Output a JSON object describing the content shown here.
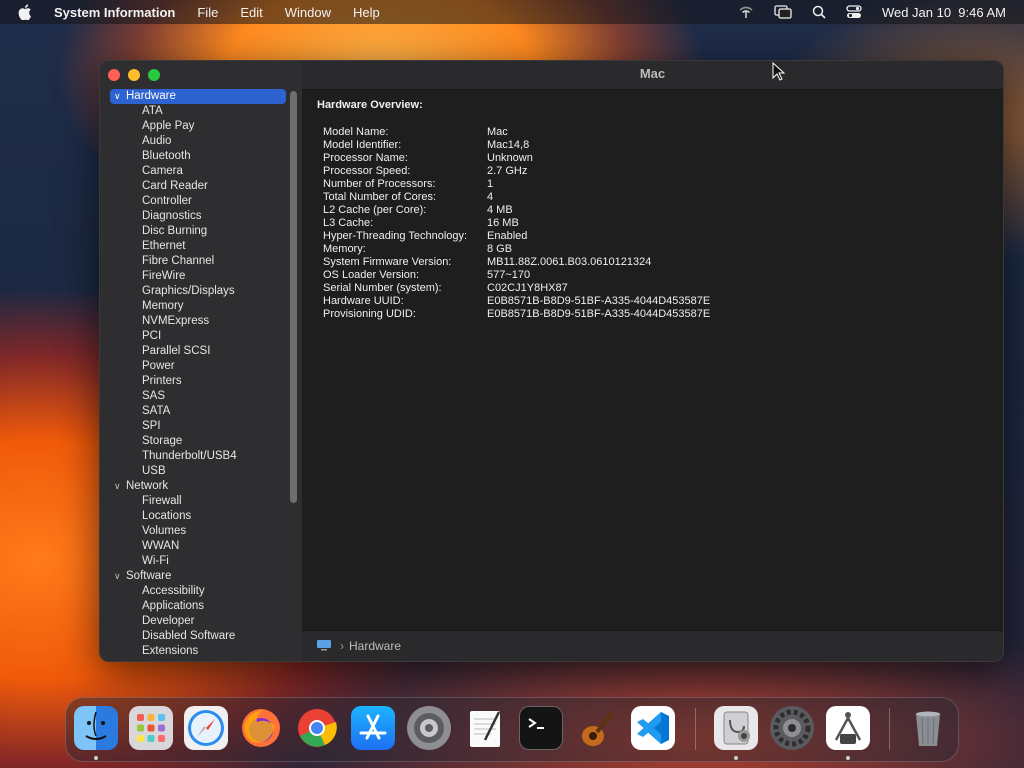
{
  "menubar": {
    "app_name": "System Information",
    "menus": [
      "File",
      "Edit",
      "Window",
      "Help"
    ],
    "clock": "Wed Jan 10  9:46 AM",
    "status_icons": [
      "wifi-icon",
      "screen-mirroring-icon",
      "spotlight-icon",
      "control-center-icon"
    ]
  },
  "window": {
    "title": "Mac",
    "sidebar": {
      "groups": [
        {
          "label": "Hardware",
          "expanded": true,
          "selected": true,
          "items": [
            "ATA",
            "Apple Pay",
            "Audio",
            "Bluetooth",
            "Camera",
            "Card Reader",
            "Controller",
            "Diagnostics",
            "Disc Burning",
            "Ethernet",
            "Fibre Channel",
            "FireWire",
            "Graphics/Displays",
            "Memory",
            "NVMExpress",
            "PCI",
            "Parallel SCSI",
            "Power",
            "Printers",
            "SAS",
            "SATA",
            "SPI",
            "Storage",
            "Thunderbolt/USB4",
            "USB"
          ]
        },
        {
          "label": "Network",
          "expanded": true,
          "selected": false,
          "items": [
            "Firewall",
            "Locations",
            "Volumes",
            "WWAN",
            "Wi-Fi"
          ]
        },
        {
          "label": "Software",
          "expanded": true,
          "selected": false,
          "items": [
            "Accessibility",
            "Applications",
            "Developer",
            "Disabled Software",
            "Extensions"
          ]
        }
      ]
    },
    "content": {
      "heading": "Hardware Overview:",
      "specs": [
        {
          "key": "Model Name:",
          "value": "Mac"
        },
        {
          "key": "Model Identifier:",
          "value": "Mac14,8"
        },
        {
          "key": "Processor Name:",
          "value": "Unknown"
        },
        {
          "key": "Processor Speed:",
          "value": "2.7 GHz"
        },
        {
          "key": "Number of Processors:",
          "value": "1"
        },
        {
          "key": "Total Number of Cores:",
          "value": "4"
        },
        {
          "key": "L2 Cache (per Core):",
          "value": "4 MB"
        },
        {
          "key": "L3 Cache:",
          "value": "16 MB"
        },
        {
          "key": "Hyper-Threading Technology:",
          "value": "Enabled"
        },
        {
          "key": "Memory:",
          "value": "8 GB"
        },
        {
          "key": "System Firmware Version:",
          "value": "MB11.88Z.0061.B03.0610121324"
        },
        {
          "key": "OS Loader Version:",
          "value": "577~170"
        },
        {
          "key": "Serial Number (system):",
          "value": "C02CJ1Y8HX87"
        },
        {
          "key": "Hardware UUID:",
          "value": "E0B8571B-B8D9-51BF-A335-4044D453587E"
        },
        {
          "key": "Provisioning UDID:",
          "value": "E0B8571B-B8D9-51BF-A335-4044D453587E"
        }
      ]
    },
    "footer": {
      "path": "Hardware"
    }
  },
  "dock": {
    "apps": [
      {
        "name": "finder-icon",
        "running": true
      },
      {
        "name": "launchpad-icon",
        "running": false
      },
      {
        "name": "safari-icon",
        "running": false
      },
      {
        "name": "firefox-icon",
        "running": false
      },
      {
        "name": "chrome-icon",
        "running": false
      },
      {
        "name": "app-store-icon",
        "running": false
      },
      {
        "name": "system-settings-icon",
        "running": false
      },
      {
        "name": "textedit-icon",
        "running": false
      },
      {
        "name": "terminal-icon",
        "running": false
      },
      {
        "name": "garageband-icon",
        "running": false
      },
      {
        "name": "vscode-icon",
        "running": false
      },
      {
        "name": "system-information-icon",
        "running": true
      },
      {
        "name": "system-preferences-icon",
        "running": false
      },
      {
        "name": "directory-utility-icon",
        "running": true
      },
      {
        "name": "trash-icon",
        "running": false
      }
    ]
  },
  "colors": {
    "selection": "#2d62d1",
    "window_bg": "#1e1e1e",
    "sidebar_bg": "#2e2e30"
  }
}
